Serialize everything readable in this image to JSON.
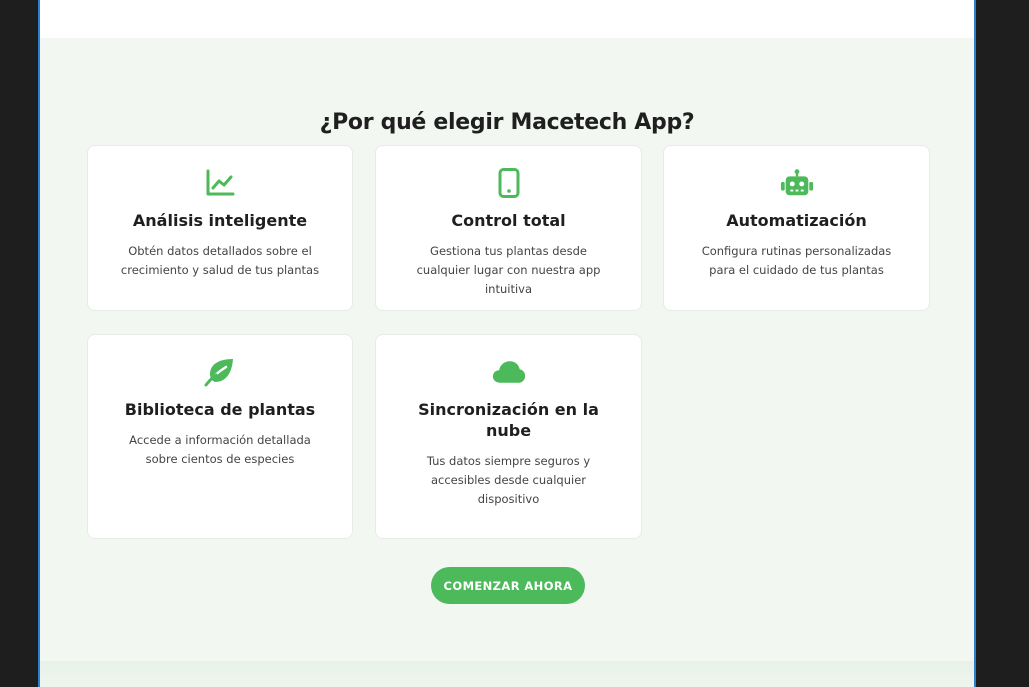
{
  "section": {
    "title": "¿Por qué elegir Macetech App?"
  },
  "features": [
    {
      "icon": "chart-line-icon",
      "title": "Análisis inteligente",
      "description": "Obtén datos detallados sobre el crecimiento y salud de tus plantas"
    },
    {
      "icon": "mobile-phone-icon",
      "title": "Control total",
      "description": "Gestiona tus plantas desde cualquier lugar con nuestra app intuitiva"
    },
    {
      "icon": "robot-icon",
      "title": "Automatización",
      "description": "Configura rutinas personalizadas para el cuidado de tus plantas"
    },
    {
      "icon": "leaf-icon",
      "title": "Biblioteca de plantas",
      "description": "Accede a información detallada sobre cientos de especies"
    },
    {
      "icon": "cloud-icon",
      "title": "Sincronización en la nube",
      "description": "Tus datos siempre seguros y accesibles desde cualquier dispositivo"
    }
  ],
  "cta": {
    "label": "COMENZAR AHORA"
  },
  "colors": {
    "accent": "#4cba5a",
    "background": "#f2f7f2",
    "card": "#ffffff",
    "frame": "#1e1e1e"
  }
}
